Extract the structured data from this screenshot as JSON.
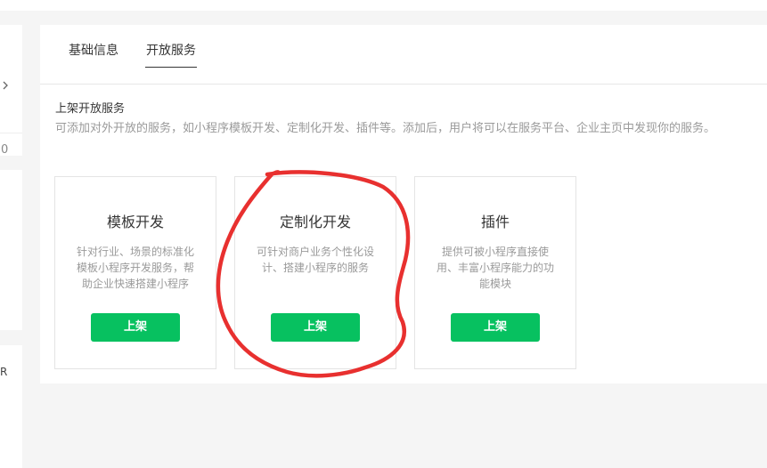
{
  "tabs": [
    {
      "label": "基础信息"
    },
    {
      "label": "开放服务"
    }
  ],
  "left_panel": {
    "digit": "0",
    "letter": "R"
  },
  "section": {
    "title": "上架开放服务",
    "description": "可添加对外开放的服务，如小程序模板开发、定制化开发、插件等。添加后，用户将可以在服务平台、企业主页中发现你的服务。"
  },
  "cards": [
    {
      "title": "模板开发",
      "description": "针对行业、场景的标准化模板小程序开发服务，帮助企业快速搭建小程序",
      "button_label": "上架"
    },
    {
      "title": "定制化开发",
      "description": "可针对商户业务个性化设计、搭建小程序的服务",
      "button_label": "上架"
    },
    {
      "title": "插件",
      "description": "提供可被小程序直接使用、丰富小程序能力的功能模块",
      "button_label": "上架"
    }
  ],
  "colors": {
    "accent": "#07c160",
    "annotation": "#e8302f"
  },
  "icons": {
    "left_chevron": "chevron-right-icon"
  }
}
